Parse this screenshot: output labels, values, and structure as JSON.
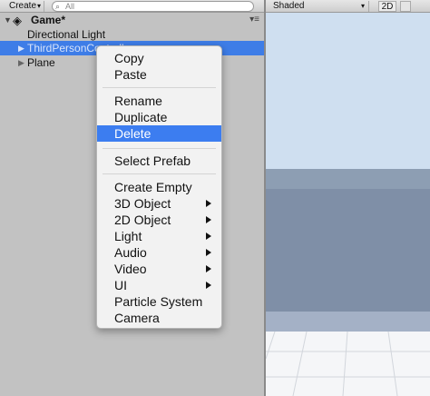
{
  "hierarchy": {
    "create_label": "Create",
    "search_placeholder": "All",
    "scene_name": "Game*",
    "objects": [
      {
        "label": "Directional Light"
      },
      {
        "label": "ThirdPersonController"
      },
      {
        "label": "Plane"
      }
    ]
  },
  "scene_view": {
    "shading_mode": "Shaded",
    "mode_2d_label": "2D"
  },
  "context_menu": {
    "items": [
      {
        "label": "Copy"
      },
      {
        "label": "Paste"
      },
      {
        "label": "Rename"
      },
      {
        "label": "Duplicate"
      },
      {
        "label": "Delete",
        "selected": true
      },
      {
        "label": "Select Prefab"
      },
      {
        "label": "Create Empty"
      },
      {
        "label": "3D Object",
        "submenu": true
      },
      {
        "label": "2D Object",
        "submenu": true
      },
      {
        "label": "Light",
        "submenu": true
      },
      {
        "label": "Audio",
        "submenu": true
      },
      {
        "label": "Video",
        "submenu": true
      },
      {
        "label": "UI",
        "submenu": true
      },
      {
        "label": "Particle System"
      },
      {
        "label": "Camera"
      }
    ]
  },
  "colors": {
    "selection": "#3c7df0",
    "hierarchy_selection": "#3e7de7",
    "panel_background": "#c2c2c2"
  }
}
